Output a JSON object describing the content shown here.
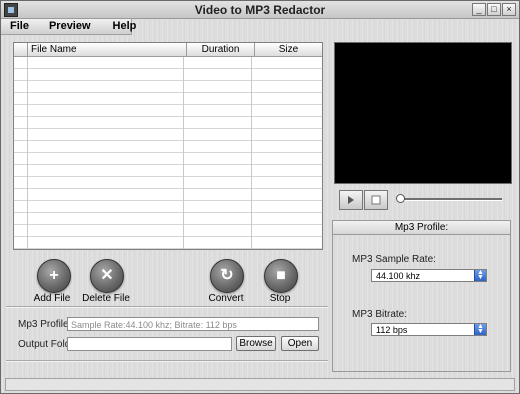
{
  "window": {
    "title": "Video to MP3 Redactor",
    "controls": {
      "minimize": "_",
      "maximize": "□",
      "close": "×"
    }
  },
  "menu": [
    "File",
    "Preview",
    "Help"
  ],
  "file_list": {
    "columns": [
      "File Name",
      "Duration",
      "Size"
    ],
    "rows": []
  },
  "actions": {
    "add_file": {
      "label": "Add File",
      "icon": "plus-icon",
      "glyph": "+"
    },
    "delete_file": {
      "label": "Delete File",
      "icon": "x-icon",
      "glyph": "✕"
    },
    "convert": {
      "label": "Convert",
      "icon": "refresh-icon",
      "glyph": "↻"
    },
    "stop": {
      "label": "Stop",
      "icon": "stop-icon",
      "glyph": "■"
    }
  },
  "profile_row": {
    "label": "Mp3 Profile:",
    "value": "Sample Rate:44.100 khz; Bitrate: 112 bps"
  },
  "output_row": {
    "label": "Output Folder:",
    "value": "",
    "browse_label": "Browse",
    "open_label": "Open"
  },
  "player": {
    "play_icon": "play-icon",
    "stop_icon": "stop-icon",
    "seek_position": 0
  },
  "profile_panel": {
    "title": "Mp3 Profile:",
    "sample_rate_label": "MP3 Sample Rate:",
    "sample_rate_value": "44.100 khz",
    "bitrate_label": "MP3 Bitrate:",
    "bitrate_value": "112 bps"
  },
  "colors": {
    "video_bg": "#000000",
    "select_arrow": "#2e63c7"
  }
}
